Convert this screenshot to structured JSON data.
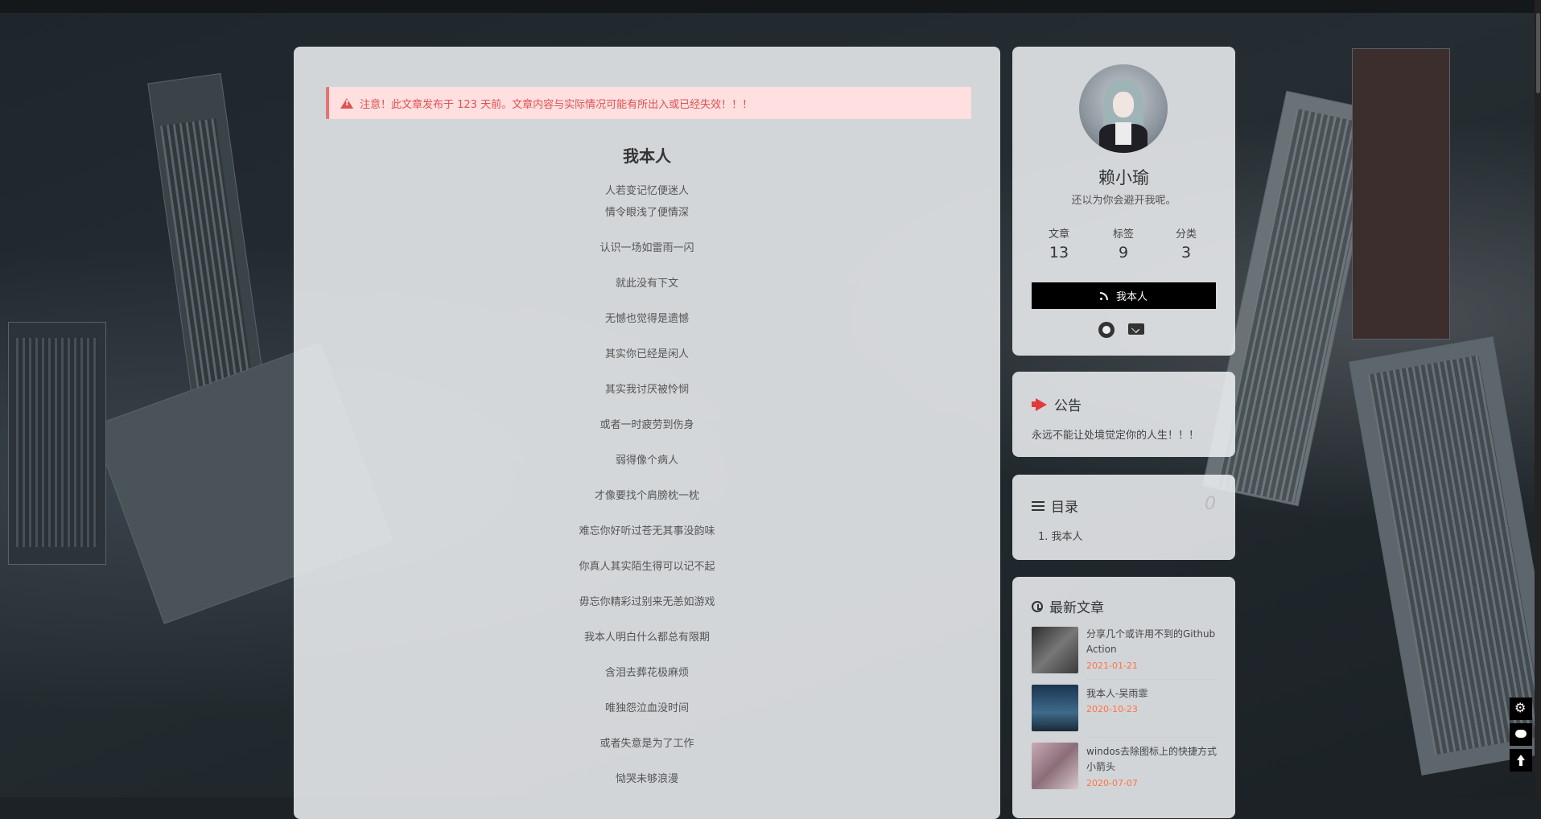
{
  "notice": {
    "text": "注意！此文章发布于 123 天前。文章内容与实际情况可能有所出入或已经失效！！！"
  },
  "post": {
    "title": "我本人",
    "lines": [
      "人若变记忆便迷人",
      "情令眼浅了便情深",
      "认识一场如雷雨一闪",
      "就此没有下文",
      "无憾也觉得是遗憾",
      "其实你已经是闲人",
      "其实我讨厌被怜悯",
      "或者一时疲劳到伤身",
      "弱得像个病人",
      "才像要找个肩膀枕一枕",
      "难忘你好听过苍无其事没韵味",
      "你真人其实陌生得可以记不起",
      "毋忘你精彩过别来无恙如游戏",
      "我本人明白什么都总有限期",
      "含泪去葬花极麻烦",
      "唯独怨泣血没时间",
      "或者失意是为了工作",
      "恸哭未够浪漫"
    ]
  },
  "author": {
    "name": "赖小瑜",
    "description": "还以为你会避开我呢。",
    "stats": [
      {
        "label": "文章",
        "value": "13"
      },
      {
        "label": "标签",
        "value": "9"
      },
      {
        "label": "分类",
        "value": "3"
      }
    ],
    "follow_label": "我本人",
    "social": [
      "github-icon",
      "email-icon"
    ]
  },
  "announcement": {
    "title": "公告",
    "text": "永远不能让处境觉定你的人生！！！"
  },
  "toc": {
    "title": "目录",
    "count": "0",
    "items": [
      "1. 我本人"
    ]
  },
  "recent": {
    "title": "最新文章",
    "items": [
      {
        "title": "分享几个或许用不到的Github Action",
        "date": "2021-01-21"
      },
      {
        "title": "我本人-吴雨霏",
        "date": "2020-10-23"
      },
      {
        "title": "windos去除图标上的快捷方式小箭头",
        "date": "2020-07-07"
      }
    ]
  },
  "colors": {
    "accent_date": "#ff7242",
    "notice_bg": "#ffdfe0",
    "notice_text": "#e05252",
    "button_bg": "#000000"
  }
}
